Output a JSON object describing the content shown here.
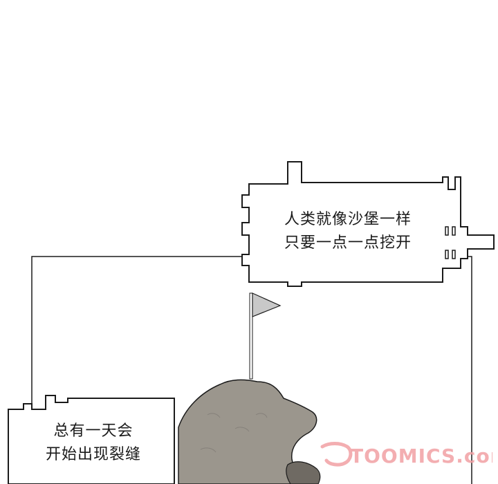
{
  "panel": {
    "caption_top": {
      "line1": "人类就像沙堡一样",
      "line2": "只要一点一点挖开"
    },
    "caption_bottom": {
      "line1": "总有一天会",
      "line2": "开始出现裂缝"
    },
    "watermark": {
      "text": "TOOMICS.com",
      "color": "#f2a0a4"
    },
    "colors": {
      "ink": "#1a1a1a",
      "sand": "#9b968d",
      "sand_dark": "#6f6a63",
      "flag": "#c8c8c8"
    }
  }
}
